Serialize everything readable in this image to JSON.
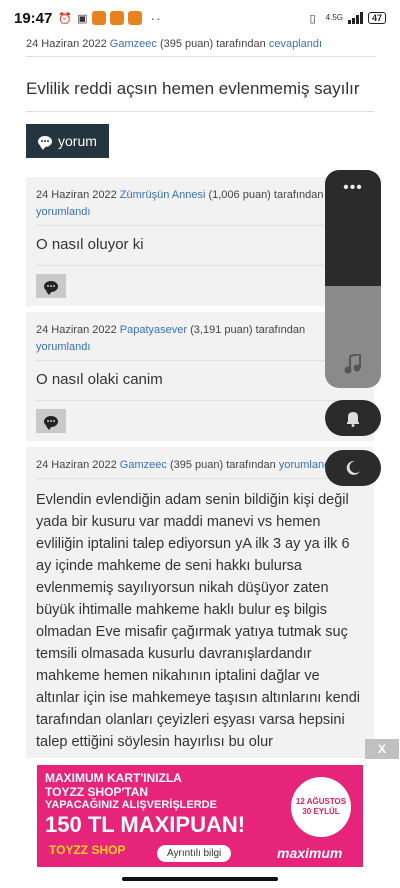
{
  "status_bar": {
    "time": "19:47",
    "network": "4.5G",
    "battery": "47"
  },
  "top_meta": {
    "date": "24 Haziran 2022",
    "user": "Gamzeec",
    "points": "(395 puan)",
    "mid": "tarafından",
    "action": "cevaplandı"
  },
  "question": {
    "title": "Evlilik reddi açsın hemen evlenmemiş sayılır",
    "comment_button": "yorum"
  },
  "comments": [
    {
      "date": "24 Haziran 2022",
      "user": "Zümrüşün Annesi",
      "points": "(1,006 puan)",
      "mid": "tarafından",
      "action": "yorumlandı",
      "text": "O nasıl oluyor ki"
    },
    {
      "date": "24 Haziran 2022",
      "user": "Papatyasever",
      "points": "(3,191 puan)",
      "mid": "tarafından",
      "action": "yorumlandı",
      "text": "O nasıl olaki canim"
    },
    {
      "date": "24 Haziran 2022",
      "user": "Gamzeec",
      "points": "(395 puan)",
      "mid": "tarafından",
      "action": "yorumlandı",
      "text": "Evlendin evlendiğin adam senin bildiğin kişi değil yada bir kusuru var maddi manevi vs hemen evliliğin iptalini talep ediyorsun yA ilk 3 ay ya ilk 6 ay içinde mahkeme de seni hakkı bulursa evlenmemiş sayılıyorsun nikah düşüyor zaten büyük ihtimalle mahkeme haklı bulur eş bilgis olmadan Eve misafir çağırmak yatıya tutmak suç temsili olmasada kusurlu davranışlardandır mahkeme hemen nikahının iptalini dağlar ve altınlar için ise mahkemeye taşısın altınlarını kendi tarafından olanları çeyizleri eşyası varsa hepsini talep ettiğini söylesin hayırlısı bu olur"
    }
  ],
  "overlay": {
    "more_icon": "more-horizontal-icon",
    "music_icon": "music-note-icon",
    "bell_icon": "bell-icon",
    "moon_icon": "moon-icon"
  },
  "ad": {
    "close": "X",
    "line1": "MAXIMUM KART'INIZLA",
    "line2": "TOYZZ SHOP'TAN",
    "line3": "YAPACAĞINIZ ALIŞVERİŞLERDE",
    "big": "150 TL MAXIPUAN!",
    "date_line1": "12 AĞUSTOS",
    "date_line2": "30 EYLÜL",
    "toyzz": "TOYZZ SHOP",
    "cta": "Ayrıntılı bilgi",
    "brand": "maximum"
  }
}
